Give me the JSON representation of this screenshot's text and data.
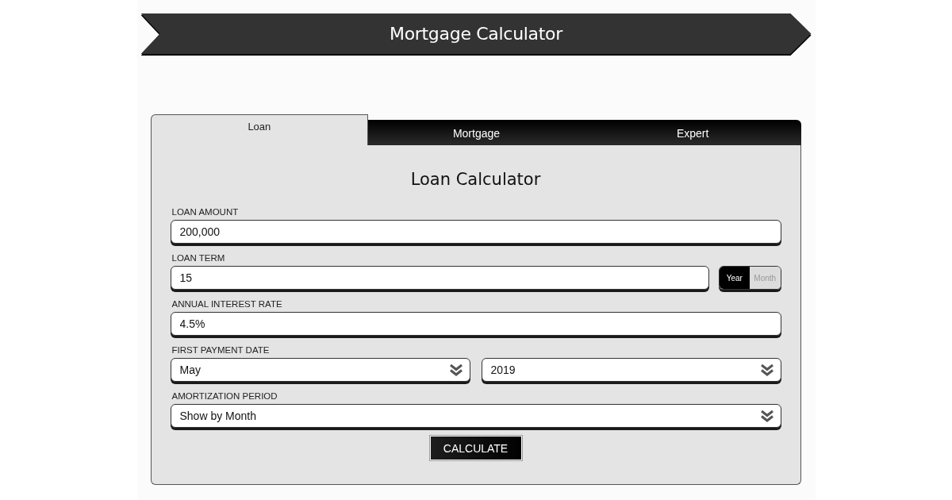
{
  "header": {
    "title": "Mortgage Calculator"
  },
  "tabs": [
    {
      "label": "Loan",
      "selected": true
    },
    {
      "label": "Mortgage",
      "selected": false
    },
    {
      "label": "Expert",
      "selected": false
    }
  ],
  "form": {
    "title": "Loan Calculator",
    "fields": [
      {
        "kind": "text",
        "label": "LOAN AMOUNT",
        "value": "200,000"
      },
      {
        "kind": "term",
        "label": "LOAN TERM",
        "value": "15",
        "units": [
          {
            "label": "Year",
            "selected": true
          },
          {
            "label": "Month",
            "selected": false
          }
        ]
      },
      {
        "kind": "text",
        "label": "ANNUAL INTEREST RATE",
        "value": "4.5%"
      },
      {
        "kind": "selects",
        "label": "FIRST PAYMENT DATE",
        "selects": [
          "May",
          "2019"
        ]
      },
      {
        "kind": "selects",
        "label": "AMORTIZATION PERIOD",
        "selects": [
          "Show by Month"
        ]
      }
    ],
    "button": "CALCULATE"
  }
}
